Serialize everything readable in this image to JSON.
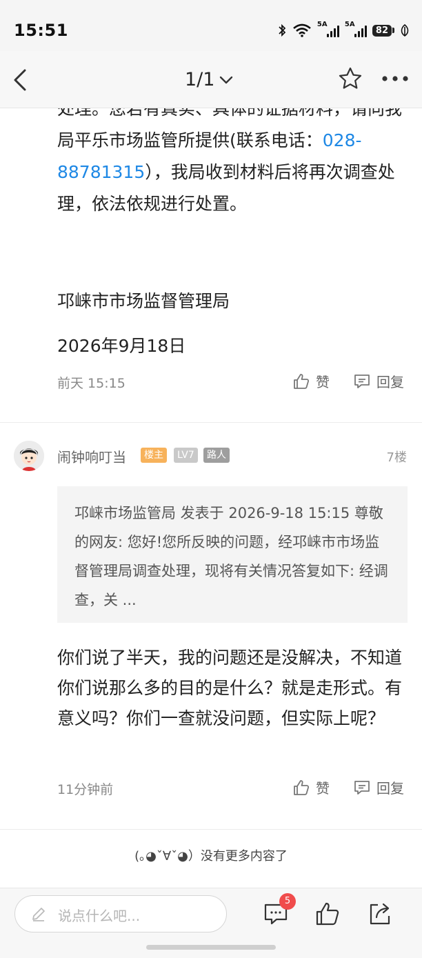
{
  "status": {
    "time": "15:51",
    "sig1": "5A",
    "sig2": "5A",
    "battery": "82"
  },
  "nav": {
    "title": "1/1",
    "back_icon": "back-arrow",
    "star_icon": "star-outline",
    "more_icon": "more-dots"
  },
  "official_reply": {
    "text_before_phone": "处理。您若有真实、具体的证据材料，请向我局平乐市场监管所提供(联系电话：",
    "phone": "028-88781315",
    "text_after_phone": "），我局收到材料后将再次调查处理，依法依规进行处置。",
    "signature_org": "邛崃市市场监督管理局",
    "signature_date": "2026年9月18日",
    "time": "前天 15:15",
    "like_label": "赞",
    "reply_label": "回复"
  },
  "comment": {
    "username": "闹钟响叮当",
    "badges": [
      {
        "label": "楼主",
        "color": "#f7b25b"
      },
      {
        "label": "LV7",
        "color": "#c9c9c9"
      },
      {
        "label": "路人",
        "color": "#9e9e9e"
      }
    ],
    "floor": "7楼",
    "quote": "邛崃市场监管局 发表于 2026-9-18 15:15 尊敬的网友: 您好!您所反映的问题，经邛崃市市场监督管理局调查处理，现将有关情况答复如下: 经调查，关 ...",
    "text": "你们说了半天，我的问题还是没解决，不知道你们说那么多的目的是什么？就是走形式。有意义吗？你们一查就没问题，但实际上呢？",
    "time": "11分钟前",
    "like_label": "赞",
    "reply_label": "回复"
  },
  "end_note": "(｡◕ˇ∀ˇ◕）没有更多内容了",
  "bottom": {
    "input_placeholder": "说点什么吧...",
    "comment_count": "5",
    "colors": {
      "accent_link": "#1e88e5",
      "badge_red": "#f04c4c"
    }
  }
}
